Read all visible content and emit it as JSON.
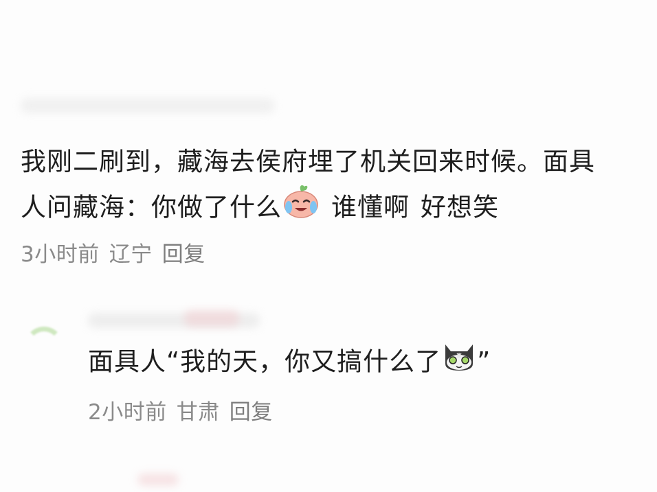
{
  "comment": {
    "text_line1": "我刚二刷到，藏海去侯府埋了机关回来时候。面具",
    "text_line2_a": "人问藏海：你做了什么",
    "text_line2_b": "谁懂啊",
    "text_line2_c": "好想笑",
    "time": "3小时前",
    "location": "辽宁",
    "reply_label": "回复",
    "emoji": "crying-peach-emoji"
  },
  "reply": {
    "text_a": "面具人“我的天，你又搞什么了",
    "text_b": "”",
    "time": "2小时前",
    "location": "甘肃",
    "reply_label": "回复",
    "emoji": "dizzy-cat-emoji"
  }
}
